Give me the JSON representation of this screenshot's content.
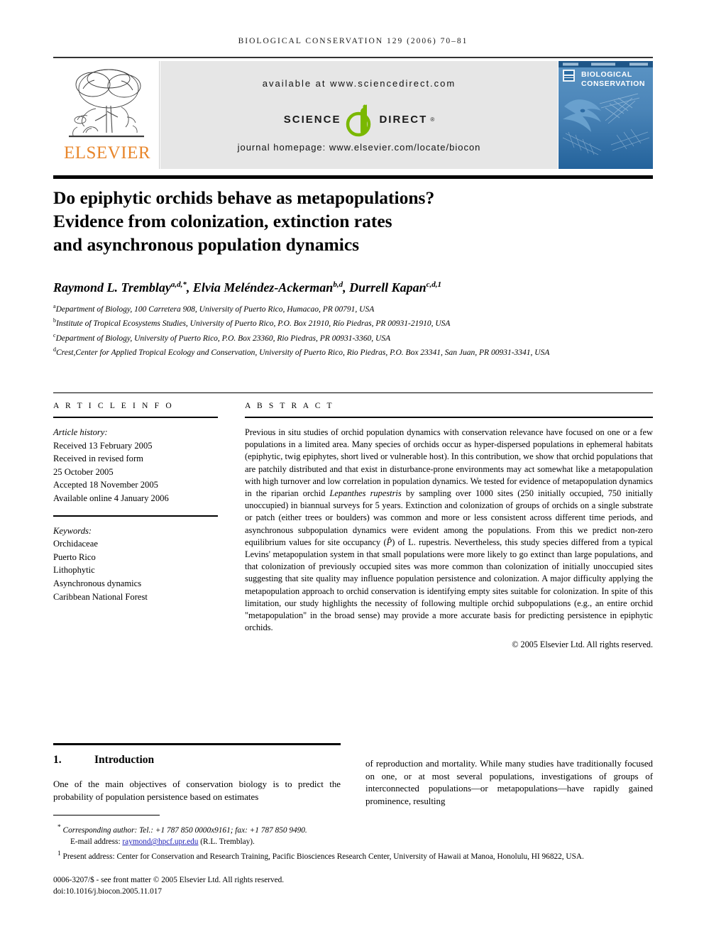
{
  "running_head": "BIOLOGICAL CONSERVATION 129 (2006) 70–81",
  "masthead": {
    "publisher_name": "ELSEVIER",
    "available_at": "available at www.sciencedirect.com",
    "sciencedirect_science": "SCIENCE",
    "sciencedirect_direct": "DIRECT",
    "sciencedirect_reg": "®",
    "journal_homepage": "journal homepage: www.elsevier.com/locate/biocon",
    "cover_title_line1": "BIOLOGICAL",
    "cover_title_line2": "CONSERVATION",
    "accent_orange": "#e8862b",
    "accent_green": "#7ab800",
    "cover_blue": "#2b6ca3"
  },
  "article": {
    "title_line1": "Do epiphytic orchids behave as metapopulations?",
    "title_line2": "Evidence from colonization, extinction rates",
    "title_line3": "and asynchronous population dynamics",
    "authors": "Raymond L. Tremblay, Elvia Meléndez-Ackerman, Durrell Kapan",
    "author_list": [
      {
        "name": "Raymond L. Tremblay",
        "marks": "a,d,*"
      },
      {
        "name": "Elvia Meléndez-Ackerman",
        "marks": "b,d"
      },
      {
        "name": "Durrell Kapan",
        "marks": "c,d,1"
      }
    ],
    "affiliations": [
      {
        "mark": "a",
        "text": "Department of Biology, 100 Carretera 908, University of Puerto Rico, Humacao, PR 00791, USA"
      },
      {
        "mark": "b",
        "text": "Institute of Tropical Ecosystems Studies, University of Puerto Rico, P.O. Box 21910, Río Piedras, PR 00931-21910, USA"
      },
      {
        "mark": "c",
        "text": "Department of Biology, University of Puerto Rico, P.O. Box 23360, Rio Piedras, PR 00931-3360, USA"
      },
      {
        "mark": "d",
        "text": "Crest,Center for Applied Tropical Ecology and Conservation, University of Puerto Rico, Rio Piedras, P.O. Box 23341, San Juan, PR 00931-3341, USA"
      }
    ]
  },
  "article_info": {
    "heading": "A R T I C L E   I N F O",
    "history_label": "Article history:",
    "history": [
      "Received 13 February 2005",
      "Received in revised form",
      "25 October 2005",
      "Accepted 18 November 2005",
      "Available online 4 January 2006"
    ],
    "keywords_label": "Keywords:",
    "keywords": [
      "Orchidaceae",
      "Puerto Rico",
      "Lithophytic",
      "Asynchronous dynamics",
      "Caribbean National Forest"
    ]
  },
  "abstract": {
    "heading": "A B S T R A C T",
    "paragraph_part1": "Previous in situ studies of orchid population dynamics with conservation relevance have focused on one or a few populations in a limited area. Many species of orchids occur as hyper-dispersed populations in ephemeral habitats (epiphytic, twig epiphytes, short lived or vulnerable host). In this contribution, we show that orchid populations that are patchily distributed and that exist in disturbance-prone environments may act somewhat like a metapopulation with high turnover and low correlation in population dynamics. We tested for evidence of metapopulation dynamics in the riparian orchid ",
    "species_italic_1": "Lepanthes rupestris",
    "paragraph_part2": " by sampling over 1000 sites (250 initially occupied, 750 initially unoccupied) in biannual surveys for 5 years. Extinction and colonization of groups of orchids on a single substrate or patch (either trees or boulders) was common and more or less consistent across different time periods, and asynchronous subpopulation dynamics were evident among the populations. From this we predict non-zero equilibrium values for site occupancy (",
    "p_hat": "P̂",
    "paragraph_part3": ") of L. rupestris. Nevertheless, this study species differed from a typical Levins' metapopulation system in that small populations were more likely to go extinct than large populations, and that colonization of previously occupied sites was more common than colonization of initially unoccupied sites suggesting that site quality may influence population persistence and colonization. A major difficulty applying the metapopulation approach to orchid conservation is identifying empty sites suitable for colonization. In spite of this limitation, our study highlights the necessity of following multiple orchid subpopulations (e.g., an entire orchid \"metapopulation\" in the broad sense) may provide a more accurate basis for predicting persistence in epiphytic orchids.",
    "copyright": "© 2005 Elsevier Ltd. All rights reserved."
  },
  "body": {
    "section_number": "1.",
    "section_title": "Introduction",
    "left_column": "One of the main objectives of conservation biology is to predict the probability of population persistence based on estimates",
    "right_column": "of reproduction and mortality. While many studies have traditionally focused on one, or at most several populations, investigations of groups of interconnected populations—or metapopulations—have rapidly gained prominence, resulting"
  },
  "footnotes": {
    "corresponding": "Corresponding author: Tel.: +1 787 850 0000x9161; fax: +1 787 850 9490.",
    "corresponding_mark": "*",
    "email_label": "E-mail address:",
    "email": "raymond@hpcf.upr.edu",
    "email_suffix": "(R.L. Tremblay).",
    "present_mark": "1",
    "present_address": "Present address: Center for Conservation and Research Training, Pacific Biosciences Research Center, University of Hawaii at Manoa, Honolulu, HI 96822, USA.",
    "issn_line": "0006-3207/$ - see front matter © 2005 Elsevier Ltd. All rights reserved.",
    "doi_line": "doi:10.1016/j.biocon.2005.11.017"
  }
}
